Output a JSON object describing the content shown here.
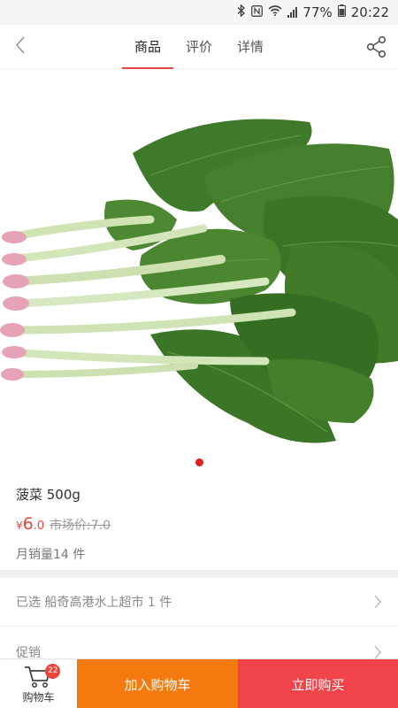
{
  "status_bar": {
    "battery": "77%",
    "time": "20:22"
  },
  "nav": {
    "tabs": [
      {
        "label": "商品",
        "active": true
      },
      {
        "label": "评价",
        "active": false
      },
      {
        "label": "详情",
        "active": false
      }
    ],
    "back_icon": "chevron-left-icon",
    "share_icon": "share-icon"
  },
  "product": {
    "name": "菠菜 500g",
    "price_symbol": "¥",
    "price_integer": "6",
    "price_decimal": ".0",
    "market_price": "市场价:7.0",
    "monthly_sales": "月销量14 件",
    "image_count": 1,
    "current_image": 1
  },
  "selection": {
    "text": "已选 船奇高港水上超市  1 件"
  },
  "promotion": {
    "label": "促销"
  },
  "bottom_bar": {
    "cart_label": "购物车",
    "cart_count": "22",
    "add_to_cart": "加入购物车",
    "buy_now": "立即购买"
  },
  "colors": {
    "accent_red": "#e8453c",
    "add_cart_orange": "#f47a10",
    "buy_now_red": "#f0444a"
  }
}
